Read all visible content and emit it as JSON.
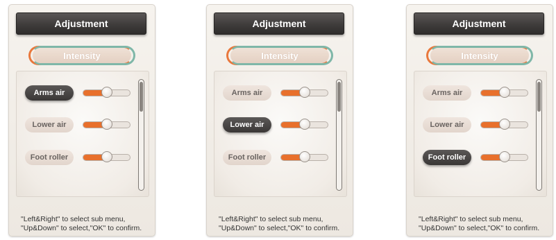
{
  "colors": {
    "accent_orange": "#e8702c",
    "accent_teal": "#7fb7a8",
    "title_bg": "#3f3c3b",
    "active_pill_bg": "#3a3736"
  },
  "panels": [
    {
      "title": "Adjustment",
      "tab_label": "Intensity",
      "selected_index": 0,
      "items": [
        {
          "label": "Arms air",
          "level": 0.5
        },
        {
          "label": "Lower air",
          "level": 0.5
        },
        {
          "label": "Foot roller",
          "level": 0.5
        }
      ],
      "help_line1": "\"Left&Right\" to select sub menu,",
      "help_line2": "\"Up&Down\" to select,\"OK\" to confirm."
    },
    {
      "title": "Adjustment",
      "tab_label": "Intensity",
      "selected_index": 1,
      "items": [
        {
          "label": "Arms air",
          "level": 0.5
        },
        {
          "label": "Lower air",
          "level": 0.5
        },
        {
          "label": "Foot roller",
          "level": 0.5
        }
      ],
      "help_line1": "\"Left&Right\" to select sub menu,",
      "help_line2": "\"Up&Down\" to select,\"OK\" to confirm."
    },
    {
      "title": "Adjustment",
      "tab_label": "Intensity",
      "selected_index": 2,
      "items": [
        {
          "label": "Arms air",
          "level": 0.5
        },
        {
          "label": "Lower air",
          "level": 0.5
        },
        {
          "label": "Foot roller",
          "level": 0.5
        }
      ],
      "help_line1": "\"Left&Right\" to select sub menu,",
      "help_line2": "\"Up&Down\" to select,\"OK\" to confirm."
    }
  ]
}
